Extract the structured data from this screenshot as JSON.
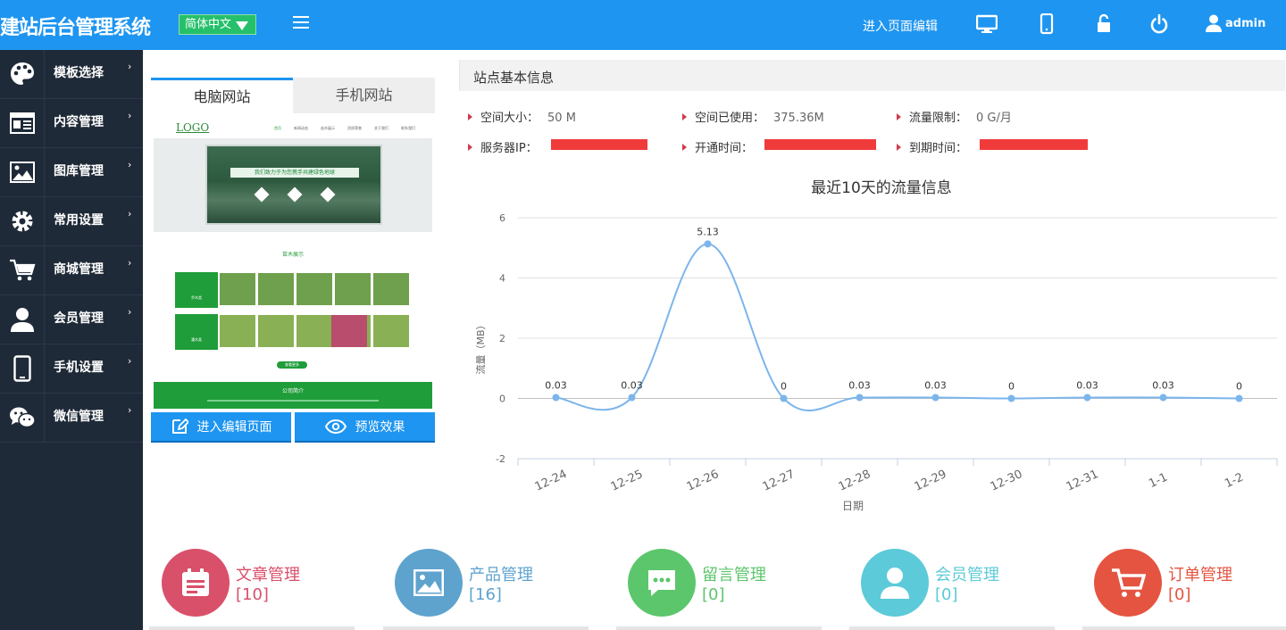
{
  "header": {
    "brand": "建站后台管理系统",
    "language": "简体中文",
    "edit_page_link": "进入页面编辑",
    "user": "admin",
    "colors": {
      "bar": "#1e95f0",
      "lang": "#26c06b"
    }
  },
  "sidebar": {
    "items": [
      {
        "label": "模板选择",
        "icon": "palette-icon"
      },
      {
        "label": "内容管理",
        "icon": "newspaper-icon"
      },
      {
        "label": "图库管理",
        "icon": "image-icon"
      },
      {
        "label": "常用设置",
        "icon": "gear-icon"
      },
      {
        "label": "商城管理",
        "icon": "cart-icon"
      },
      {
        "label": "会员管理",
        "icon": "user-icon"
      },
      {
        "label": "手机设置",
        "icon": "phone-icon"
      },
      {
        "label": "微信管理",
        "icon": "wechat-icon"
      }
    ]
  },
  "preview": {
    "tabs": [
      "电脑网站",
      "手机网站"
    ],
    "mock": {
      "logo": "LOGO",
      "nav": [
        "首页",
        "新闻动态",
        "苗木展示",
        "资质荣誉",
        "关于我们",
        "联系我们"
      ],
      "banner_text": "我们致力于为您携手共建绿色地球",
      "section_title": "苗木展示",
      "category_1": "乔木类",
      "category_2": "灌木类",
      "more_button": "查看更多",
      "company_title": "公司简介"
    },
    "edit_button": "进入编辑页面",
    "preview_button": "预览效果"
  },
  "info": {
    "title": "站点基本信息",
    "rows": [
      [
        {
          "label": "空间大小：",
          "value": "50 M"
        },
        {
          "label": "空间已使用：",
          "value": "375.36M"
        },
        {
          "label": "流量限制：",
          "value": "0 G/月"
        }
      ],
      [
        {
          "label": "服务器IP：",
          "value": ""
        },
        {
          "label": "开通时间：",
          "value": ""
        },
        {
          "label": "到期时间：",
          "value": ""
        }
      ]
    ]
  },
  "chart_data": {
    "type": "line",
    "title": "最近10天的流量信息",
    "xlabel": "日期",
    "ylabel": "流量（MB）",
    "categories": [
      "12-24",
      "12-25",
      "12-26",
      "12-27",
      "12-28",
      "12-29",
      "12-30",
      "12-31",
      "1-1",
      "1-2"
    ],
    "values": [
      0.03,
      0.03,
      5.13,
      0,
      0.03,
      0.03,
      0,
      0.03,
      0.03,
      0
    ],
    "labels": [
      "0.03",
      "0.03",
      "5.13",
      "0",
      "0.03",
      "0.03",
      "0",
      "0.03",
      "0.03",
      "0"
    ],
    "yticks": [
      -2,
      0,
      2,
      4,
      6
    ],
    "ylim": [
      -2,
      6
    ],
    "grid": true,
    "smooth": true,
    "color": "#7cb5ec"
  },
  "cards": [
    {
      "title": "文章管理",
      "count": "[10]",
      "color": "#d9506a",
      "icon": "calendar-icon"
    },
    {
      "title": "产品管理",
      "count": "[16]",
      "color": "#5ea3ce",
      "icon": "picture-icon"
    },
    {
      "title": "留言管理",
      "count": "[0]",
      "color": "#5cc66c",
      "icon": "chat-icon"
    },
    {
      "title": "会员管理",
      "count": "[0]",
      "color": "#5ccad8",
      "icon": "member-icon"
    },
    {
      "title": "订单管理",
      "count": "[0]",
      "color": "#e55440",
      "icon": "cart-icon"
    }
  ]
}
